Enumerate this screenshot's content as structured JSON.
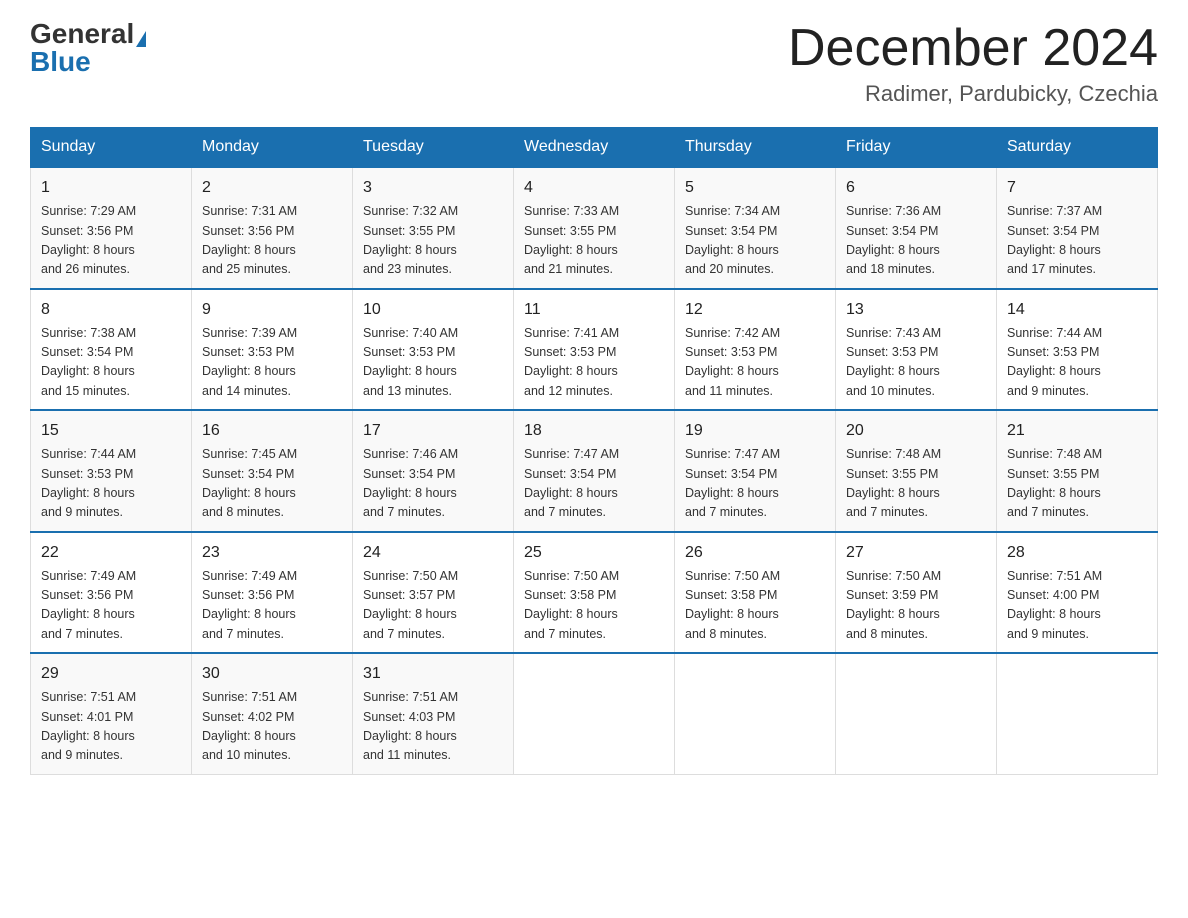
{
  "header": {
    "logo_general": "General",
    "logo_blue": "Blue",
    "month_year": "December 2024",
    "location": "Radimer, Pardubicky, Czechia"
  },
  "days_of_week": [
    "Sunday",
    "Monday",
    "Tuesday",
    "Wednesday",
    "Thursday",
    "Friday",
    "Saturday"
  ],
  "weeks": [
    [
      {
        "date": "1",
        "sunrise": "7:29 AM",
        "sunset": "3:56 PM",
        "daylight": "8 hours and 26 minutes."
      },
      {
        "date": "2",
        "sunrise": "7:31 AM",
        "sunset": "3:56 PM",
        "daylight": "8 hours and 25 minutes."
      },
      {
        "date": "3",
        "sunrise": "7:32 AM",
        "sunset": "3:55 PM",
        "daylight": "8 hours and 23 minutes."
      },
      {
        "date": "4",
        "sunrise": "7:33 AM",
        "sunset": "3:55 PM",
        "daylight": "8 hours and 21 minutes."
      },
      {
        "date": "5",
        "sunrise": "7:34 AM",
        "sunset": "3:54 PM",
        "daylight": "8 hours and 20 minutes."
      },
      {
        "date": "6",
        "sunrise": "7:36 AM",
        "sunset": "3:54 PM",
        "daylight": "8 hours and 18 minutes."
      },
      {
        "date": "7",
        "sunrise": "7:37 AM",
        "sunset": "3:54 PM",
        "daylight": "8 hours and 17 minutes."
      }
    ],
    [
      {
        "date": "8",
        "sunrise": "7:38 AM",
        "sunset": "3:54 PM",
        "daylight": "8 hours and 15 minutes."
      },
      {
        "date": "9",
        "sunrise": "7:39 AM",
        "sunset": "3:53 PM",
        "daylight": "8 hours and 14 minutes."
      },
      {
        "date": "10",
        "sunrise": "7:40 AM",
        "sunset": "3:53 PM",
        "daylight": "8 hours and 13 minutes."
      },
      {
        "date": "11",
        "sunrise": "7:41 AM",
        "sunset": "3:53 PM",
        "daylight": "8 hours and 12 minutes."
      },
      {
        "date": "12",
        "sunrise": "7:42 AM",
        "sunset": "3:53 PM",
        "daylight": "8 hours and 11 minutes."
      },
      {
        "date": "13",
        "sunrise": "7:43 AM",
        "sunset": "3:53 PM",
        "daylight": "8 hours and 10 minutes."
      },
      {
        "date": "14",
        "sunrise": "7:44 AM",
        "sunset": "3:53 PM",
        "daylight": "8 hours and 9 minutes."
      }
    ],
    [
      {
        "date": "15",
        "sunrise": "7:44 AM",
        "sunset": "3:53 PM",
        "daylight": "8 hours and 9 minutes."
      },
      {
        "date": "16",
        "sunrise": "7:45 AM",
        "sunset": "3:54 PM",
        "daylight": "8 hours and 8 minutes."
      },
      {
        "date": "17",
        "sunrise": "7:46 AM",
        "sunset": "3:54 PM",
        "daylight": "8 hours and 7 minutes."
      },
      {
        "date": "18",
        "sunrise": "7:47 AM",
        "sunset": "3:54 PM",
        "daylight": "8 hours and 7 minutes."
      },
      {
        "date": "19",
        "sunrise": "7:47 AM",
        "sunset": "3:54 PM",
        "daylight": "8 hours and 7 minutes."
      },
      {
        "date": "20",
        "sunrise": "7:48 AM",
        "sunset": "3:55 PM",
        "daylight": "8 hours and 7 minutes."
      },
      {
        "date": "21",
        "sunrise": "7:48 AM",
        "sunset": "3:55 PM",
        "daylight": "8 hours and 7 minutes."
      }
    ],
    [
      {
        "date": "22",
        "sunrise": "7:49 AM",
        "sunset": "3:56 PM",
        "daylight": "8 hours and 7 minutes."
      },
      {
        "date": "23",
        "sunrise": "7:49 AM",
        "sunset": "3:56 PM",
        "daylight": "8 hours and 7 minutes."
      },
      {
        "date": "24",
        "sunrise": "7:50 AM",
        "sunset": "3:57 PM",
        "daylight": "8 hours and 7 minutes."
      },
      {
        "date": "25",
        "sunrise": "7:50 AM",
        "sunset": "3:58 PM",
        "daylight": "8 hours and 7 minutes."
      },
      {
        "date": "26",
        "sunrise": "7:50 AM",
        "sunset": "3:58 PM",
        "daylight": "8 hours and 8 minutes."
      },
      {
        "date": "27",
        "sunrise": "7:50 AM",
        "sunset": "3:59 PM",
        "daylight": "8 hours and 8 minutes."
      },
      {
        "date": "28",
        "sunrise": "7:51 AM",
        "sunset": "4:00 PM",
        "daylight": "8 hours and 9 minutes."
      }
    ],
    [
      {
        "date": "29",
        "sunrise": "7:51 AM",
        "sunset": "4:01 PM",
        "daylight": "8 hours and 9 minutes."
      },
      {
        "date": "30",
        "sunrise": "7:51 AM",
        "sunset": "4:02 PM",
        "daylight": "8 hours and 10 minutes."
      },
      {
        "date": "31",
        "sunrise": "7:51 AM",
        "sunset": "4:03 PM",
        "daylight": "8 hours and 11 minutes."
      },
      null,
      null,
      null,
      null
    ]
  ],
  "labels": {
    "sunrise": "Sunrise:",
    "sunset": "Sunset:",
    "daylight": "Daylight:"
  }
}
